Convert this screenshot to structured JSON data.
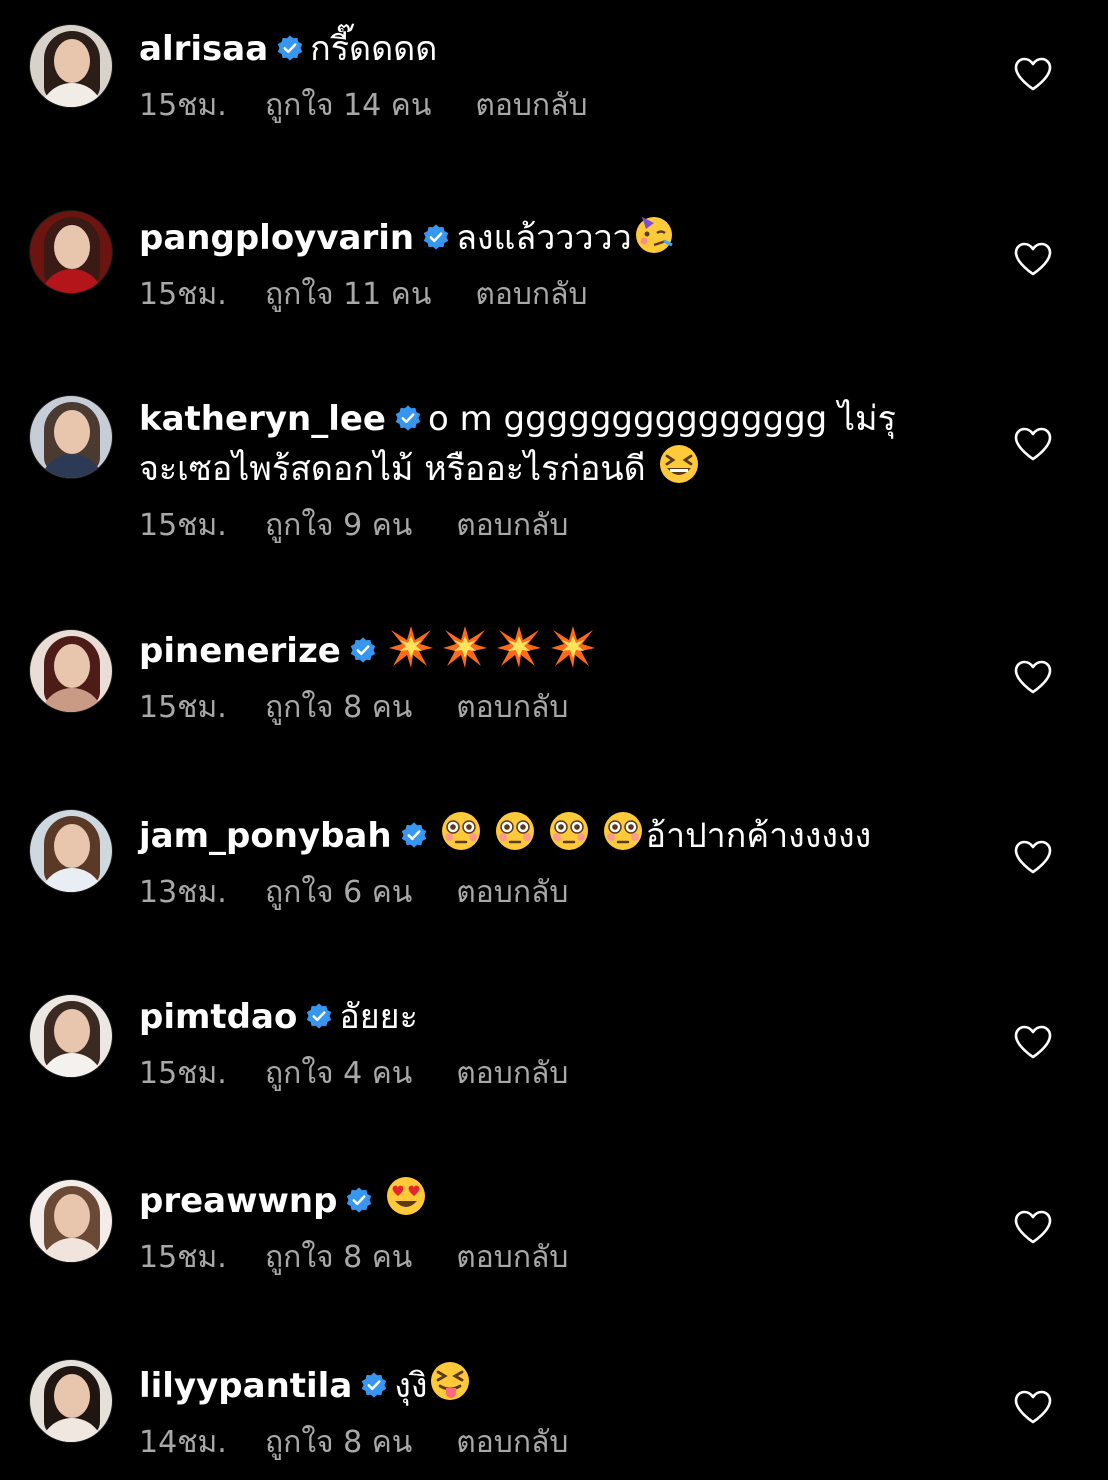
{
  "colors": {
    "background": "#000000",
    "text": "#ffffff",
    "meta_text": "#a8a8a8",
    "verified_badge": "#3797f0"
  },
  "comments": [
    {
      "username": "alrisaa",
      "verified": true,
      "text": "กรี๊ดดดด",
      "time": "15ชม.",
      "likes": "ถูกใจ 14 คน",
      "reply": "ตอบกลับ",
      "avatar_colors": {
        "hair": "#2b1d18",
        "body": "#f2ece6",
        "bg": "#d9d2cb"
      }
    },
    {
      "username": "pangployvarin",
      "verified": true,
      "text": "ลงแล้ววววว",
      "emoji": "partying-face",
      "time": "15ชม.",
      "likes": "ถูกใจ 11 คน",
      "reply": "ตอบกลับ",
      "avatar_colors": {
        "hair": "#3a1a14",
        "body": "#b3151a",
        "bg": "#6b1410"
      }
    },
    {
      "username": "katheryn_lee",
      "verified": true,
      "text": "o m ggggggggggggggg ไม่รุ",
      "text_line2": "จะเซอไพร้สดอกไม้ หรืออะไรก่อนดี",
      "emoji": "grinning-squinting-face",
      "time": "15ชม.",
      "likes": "ถูกใจ 9 คน",
      "reply": "ตอบกลับ",
      "avatar_colors": {
        "hair": "#4a3a30",
        "body": "#2c3a55",
        "bg": "#c7cdd6"
      }
    },
    {
      "username": "pinenerize",
      "verified": true,
      "text": "",
      "emoji_row": [
        "collision",
        "collision",
        "collision",
        "collision"
      ],
      "time": "15ชม.",
      "likes": "ถูกใจ 8 คน",
      "reply": "ตอบกลับ",
      "avatar_colors": {
        "hair": "#4d1c16",
        "body": "#c99a86",
        "bg": "#e9ddd6"
      }
    },
    {
      "username": "jam_ponybah",
      "verified": true,
      "text": "อ้าปากค้างงงงง",
      "emoji_row": [
        "flushed-face",
        "flushed-face",
        "flushed-face",
        "flushed-face"
      ],
      "time": "13ชม.",
      "likes": "ถูกใจ 6 คน",
      "reply": "ตอบกลับ",
      "avatar_colors": {
        "hair": "#5a3a26",
        "body": "#e8eef3",
        "bg": "#cfd8df"
      }
    },
    {
      "username": "pimtdao",
      "verified": true,
      "text": "อัยยะ",
      "time": "15ชม.",
      "likes": "ถูกใจ 4 คน",
      "reply": "ตอบกลับ",
      "avatar_colors": {
        "hair": "#3b2a22",
        "body": "#f4f1ee",
        "bg": "#ece7e2"
      }
    },
    {
      "username": "preawwnp",
      "verified": true,
      "text": "",
      "emoji": "smiling-face-with-heart-eyes",
      "time": "15ชม.",
      "likes": "ถูกใจ 8 คน",
      "reply": "ตอบกลับ",
      "avatar_colors": {
        "hair": "#6a4a36",
        "body": "#f1e4dc",
        "bg": "#f3ece8"
      }
    },
    {
      "username": "lilyypantila",
      "verified": true,
      "text": "งุงิ",
      "emoji": "squinting-face-with-tongue",
      "time": "14ชม.",
      "likes": "ถูกใจ 8 คน",
      "reply": "ตอบกลับ",
      "avatar_colors": {
        "hair": "#1f1612",
        "body": "#efe7e0",
        "bg": "#e6e0da"
      }
    }
  ]
}
